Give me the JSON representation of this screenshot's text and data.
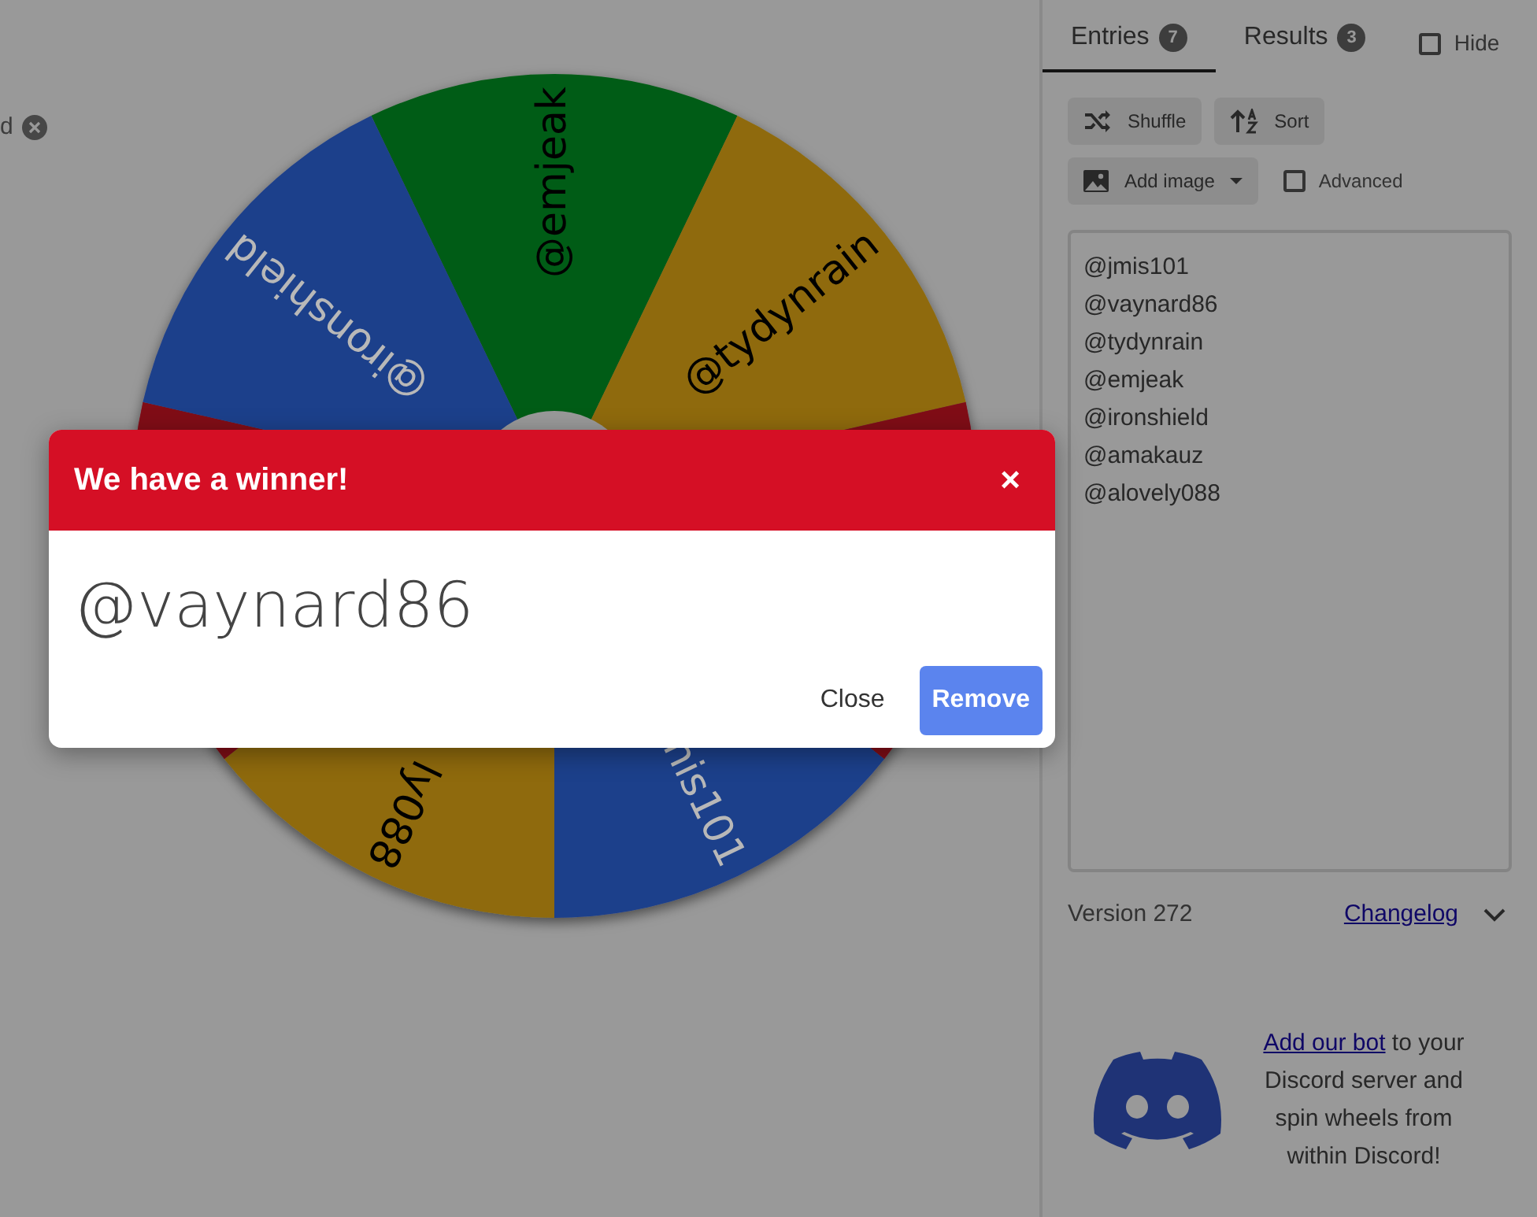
{
  "chip": {
    "label": "d"
  },
  "wheel": {
    "segments": [
      {
        "label": "@emjeak",
        "color": "#005c16"
      },
      {
        "label": "@tydynrain",
        "color": "#8f6b0a"
      },
      {
        "color": "#800916"
      },
      {
        "label": "nis101",
        "color": "#1f3f8b"
      },
      {
        "label": "ly088",
        "color": "#8f6b0a"
      },
      {
        "color": "#800916"
      },
      {
        "label": "@ironshield",
        "color": "#1f3f8b"
      }
    ]
  },
  "tabs": [
    {
      "label": "Entries",
      "count": "7",
      "selected": true
    },
    {
      "label": "Results",
      "count": "3",
      "selected": false
    }
  ],
  "hide": {
    "label": "Hide",
    "checked": false
  },
  "toolbar": [
    {
      "label": "Shuffle",
      "kind": "shuffle"
    },
    {
      "label": "Sort",
      "kind": "sort"
    }
  ],
  "add_image": {
    "label": "Add image"
  },
  "advanced": {
    "label": "Advanced",
    "checked": false
  },
  "entries": [
    "@jmis101",
    "@vaynard86",
    "@tydynrain",
    "@emjeak",
    "@ironshield",
    "@amakauz",
    "@alovely088"
  ],
  "version": "Version 272",
  "changelog": "Changelog",
  "discord": {
    "link": "Add our bot",
    "text": " to your Discord server and spin wheels from within Discord!"
  },
  "modal": {
    "title": "We have a winner!",
    "close_icon": "×",
    "winner": "@vaynard86",
    "buttons": [
      {
        "label": "Close",
        "kind": "text"
      },
      {
        "label": "Remove",
        "kind": "primary"
      }
    ]
  }
}
